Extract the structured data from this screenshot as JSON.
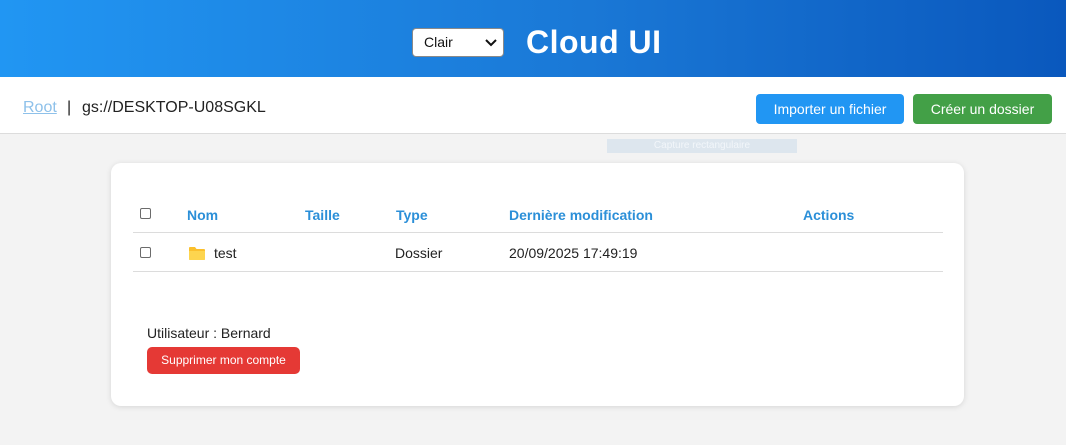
{
  "header": {
    "theme_select": {
      "value": "Clair"
    },
    "title": "Cloud UI"
  },
  "breadcrumb": {
    "root": "Root",
    "separator": "|",
    "path": "gs://DESKTOP-U08SGKL"
  },
  "toolbar": {
    "import_label": "Importer un fichier",
    "create_folder_label": "Créer un dossier"
  },
  "overlay": {
    "capture_label": "Capture rectangulaire"
  },
  "table": {
    "columns": [
      "Nom",
      "Taille",
      "Type",
      "Dernière modification",
      "Actions"
    ],
    "rows": [
      {
        "name": "test",
        "size": "",
        "type": "Dossier",
        "modified": "20/09/2025 17:49:19",
        "icon": "folder-icon"
      }
    ]
  },
  "user": {
    "label": "Utilisateur : Bernard",
    "delete_label": "Supprimer mon compte"
  },
  "colors": {
    "header_start": "#2196f3",
    "header_end": "#0a58bd",
    "accent_blue": "#2196f3",
    "green": "#43a047",
    "red": "#e53935",
    "folder": "#fbc02d"
  }
}
